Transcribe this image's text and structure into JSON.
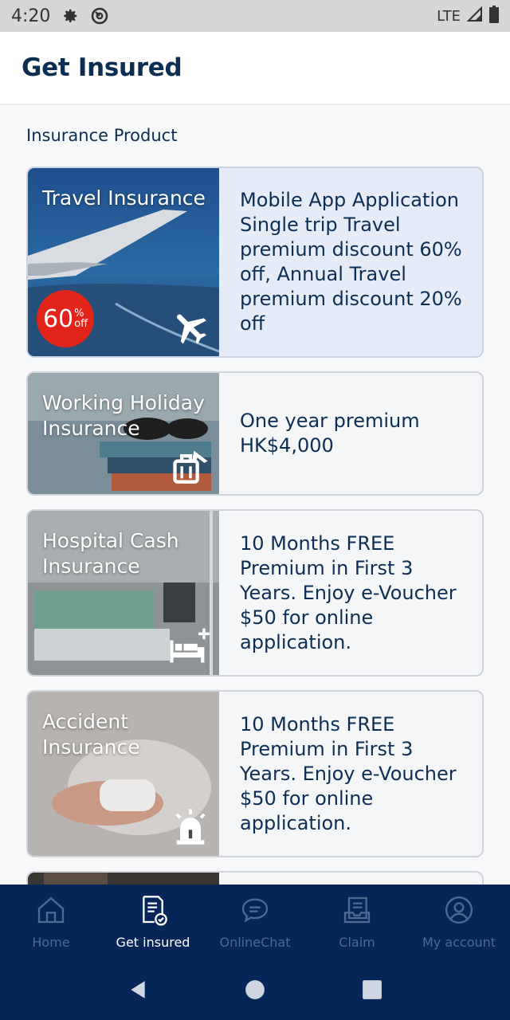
{
  "status_bar": {
    "time": "4:20",
    "network": "LTE"
  },
  "header": {
    "title": "Get Insured"
  },
  "section_label": "Insurance Product",
  "products": [
    {
      "title": "Travel Insurance",
      "description": "Mobile App Application Single trip Travel premium discount 60% off, Annual Travel premium discount 20% off",
      "icon": "airplane-icon",
      "badge": {
        "number": "60",
        "percent": "%",
        "unit": "off"
      }
    },
    {
      "title": "Working Holiday Insurance",
      "description": "One year premium HK$4,000",
      "icon": "luggage-plane-icon"
    },
    {
      "title": "Hospital Cash Insurance",
      "description": "10 Months FREE Premium in First 3 Years. Enjoy e-Voucher $50 for online application.",
      "icon": "hospital-bed-icon"
    },
    {
      "title": "Accident Insurance",
      "description": "10 Months FREE Premium in First 3 Years. Enjoy e-Voucher $50 for online application.",
      "icon": "siren-icon"
    }
  ],
  "bottom_nav": [
    {
      "label": "Home",
      "icon": "home-icon",
      "active": false
    },
    {
      "label": "Get insured",
      "icon": "document-check-icon",
      "active": true
    },
    {
      "label": "OnlineChat",
      "icon": "chat-icon",
      "active": false
    },
    {
      "label": "Claim",
      "icon": "claim-icon",
      "active": false
    },
    {
      "label": "My account",
      "icon": "account-icon",
      "active": false
    }
  ],
  "colors": {
    "primary": "#0c2e55",
    "nav_bg": "#062558",
    "badge": "#e3241b",
    "highlight_card": "#e5ecf7"
  }
}
